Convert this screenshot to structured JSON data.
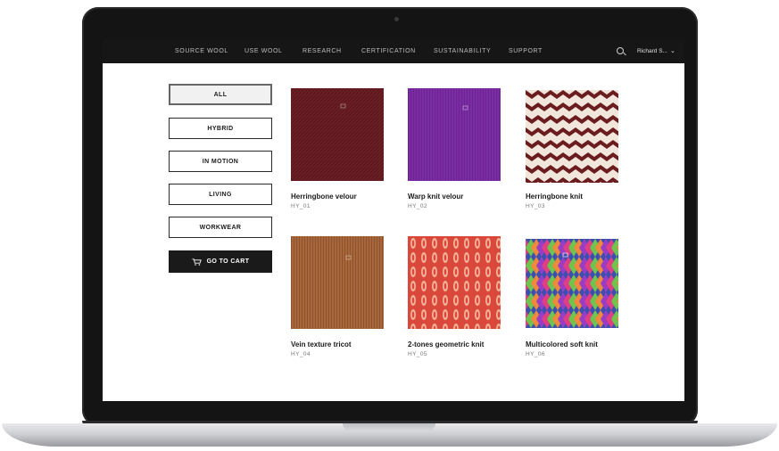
{
  "nav": {
    "items": [
      "SOURCE WOOL",
      "USE WOOL",
      "RESEARCH",
      "CERTIFICATION",
      "SUSTAINABILITY",
      "SUPPORT"
    ],
    "user_label": "Richard S...",
    "user_menu_icon": "chevron-down-icon",
    "search_icon": "search-icon"
  },
  "sidebar": {
    "filters": [
      {
        "label": "ALL",
        "active": true
      },
      {
        "label": "HYBRID",
        "active": false
      },
      {
        "label": "IN MOTION",
        "active": false
      },
      {
        "label": "LIVING",
        "active": false
      },
      {
        "label": "WORKWEAR",
        "active": false
      }
    ],
    "cart_label": "GO TO CART",
    "cart_icon": "cart-icon"
  },
  "products": [
    {
      "name": "Herringbone velour",
      "code": "HY_01",
      "color": "#6b1f26"
    },
    {
      "name": "Warp knit velour",
      "code": "HY_02",
      "color": "#7a2ca3"
    },
    {
      "name": "Herringbone knit",
      "code": "HY_03",
      "color": "#6a1c1f"
    },
    {
      "name": "Vein texture tricot",
      "code": "HY_04",
      "color": "#a8673a"
    },
    {
      "name": "2-tones geometric knit",
      "code": "HY_05",
      "color": "#d9483b"
    },
    {
      "name": "Multicolored soft knit",
      "code": "HY_06",
      "color": "#c2357a"
    }
  ],
  "colors": {
    "nav_bg": "#161616",
    "cart_bg": "#1a1a1a"
  }
}
